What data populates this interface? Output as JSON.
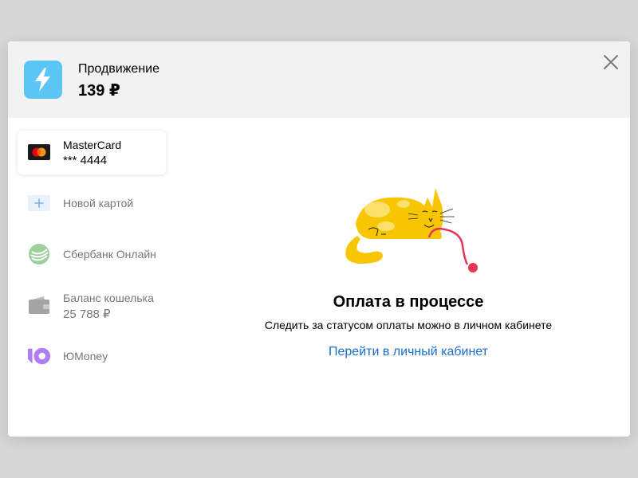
{
  "header": {
    "product_name": "Продвижение",
    "price": "139 ₽",
    "icon": "lightning-icon",
    "accent_color": "#5bc6f5"
  },
  "payment_methods": [
    {
      "icon": "mastercard-icon",
      "label": "MasterCard",
      "sub": "*** 4444",
      "active": true
    },
    {
      "icon": "plus-icon",
      "label": "Новой картой"
    },
    {
      "icon": "sberbank-icon",
      "label": "Сбербанк Онлайн"
    },
    {
      "icon": "wallet-icon",
      "label": "Баланс кошелька",
      "sub": "25 788 ₽"
    },
    {
      "icon": "yoomoney-icon",
      "label": "ЮMoney"
    }
  ],
  "status": {
    "title": "Оплата в процессе",
    "subtitle": "Следить за статусом оплаты можно в личном кабинете",
    "link": "Перейти в личный кабинет",
    "link_color": "#1a6dcc"
  }
}
